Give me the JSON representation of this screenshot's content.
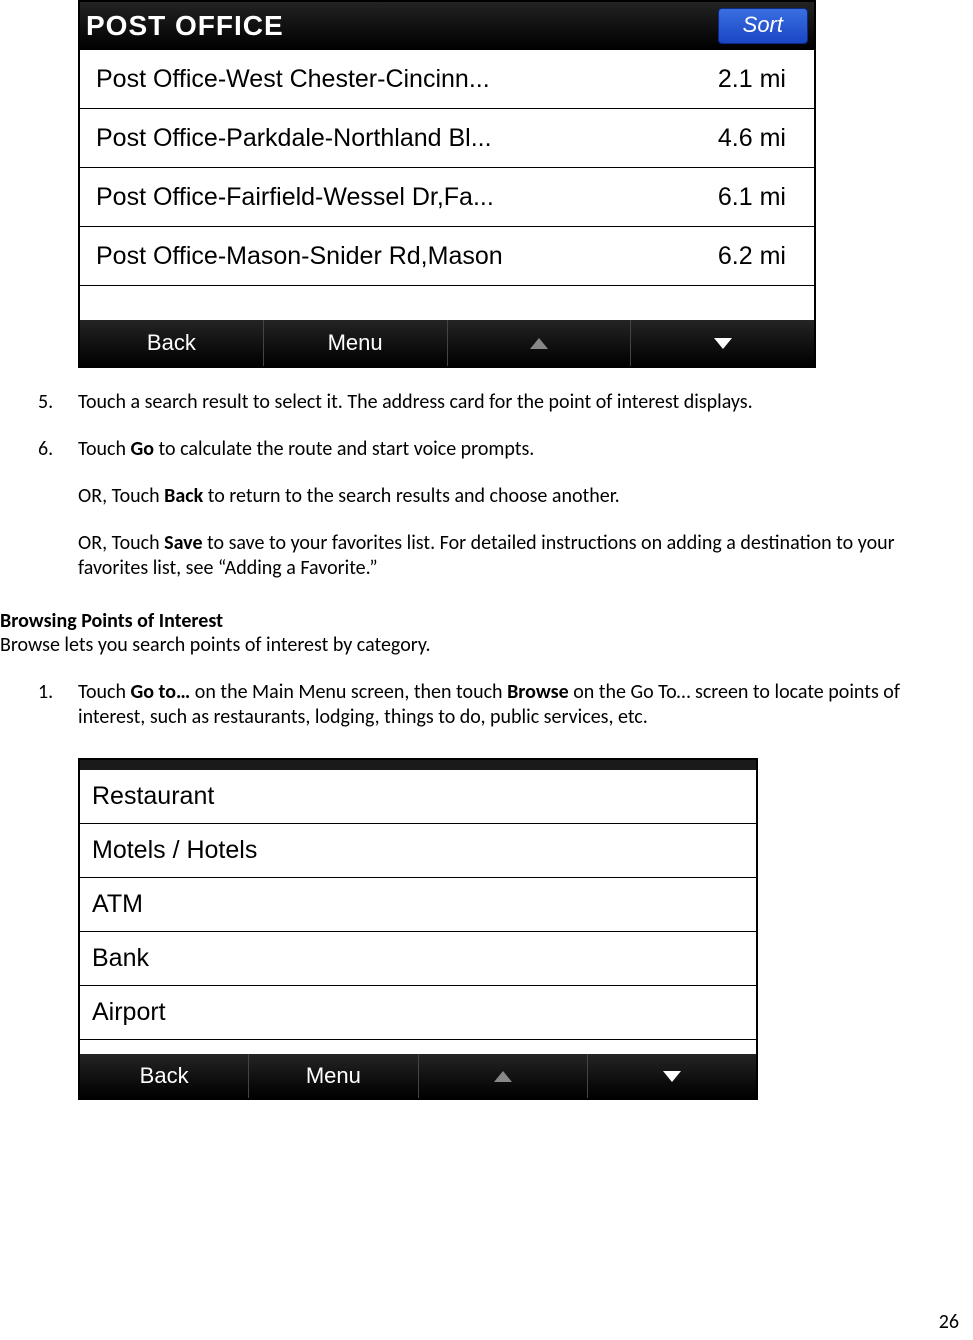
{
  "device1": {
    "title": "POST OFFICE",
    "sort_label": "Sort",
    "results": [
      {
        "name": "Post Office-West Chester-Cincinn...",
        "dist": "2.1 mi"
      },
      {
        "name": "Post Office-Parkdale-Northland Bl...",
        "dist": "4.6 mi"
      },
      {
        "name": "Post Office-Fairfield-Wessel Dr,Fa...",
        "dist": "6.1 mi"
      },
      {
        "name": "Post Office-Mason-Snider Rd,Mason",
        "dist": "6.2 mi"
      }
    ],
    "bottombar": {
      "back": "Back",
      "menu": "Menu"
    }
  },
  "steps": {
    "n5": "5.",
    "s5": "Touch a search result to select it. The address card for the point of interest displays.",
    "n6": "6.",
    "s6a_pre": "Touch ",
    "s6a_bold": "Go",
    "s6a_post": " to calculate the route and start voice prompts.",
    "s6b_pre": "OR, Touch ",
    "s6b_bold": "Back",
    "s6b_post": " to return to the search results and choose another.",
    "s6c_pre": "OR, Touch ",
    "s6c_bold": "Save",
    "s6c_post": " to save to your favorites list. For detailed instructions on adding a destination to your favorites list, see “Adding a Favorite.”"
  },
  "section": {
    "heading": "Browsing Points of Interest",
    "intro": "Browse lets you search points of interest by category.",
    "n1": "1.",
    "s1_t1": "Touch ",
    "s1_b1": "Go to…",
    "s1_t2": " on the Main Menu screen, then touch ",
    "s1_b2": "Browse",
    "s1_t3": " on the Go To… screen to locate points of interest, such as restaurants, lodging, things to do, public services, etc."
  },
  "device2": {
    "categories": [
      "Restaurant",
      "Motels / Hotels",
      "ATM",
      "Bank",
      "Airport"
    ],
    "bottombar": {
      "back": "Back",
      "menu": "Menu"
    }
  },
  "page_number": "26"
}
